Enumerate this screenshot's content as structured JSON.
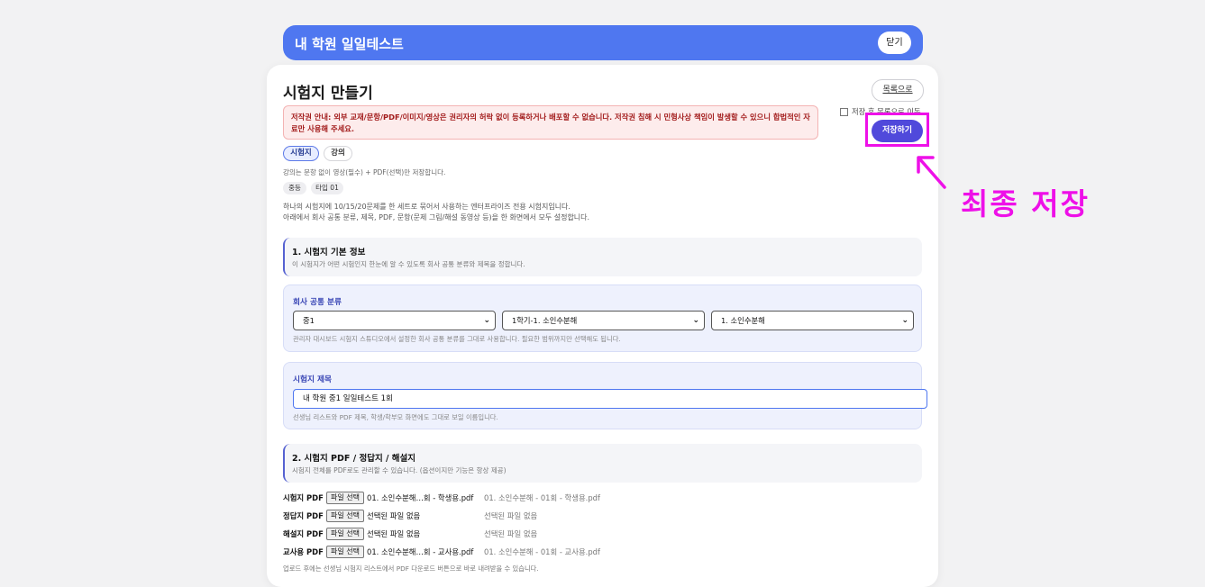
{
  "app": {
    "title": "내 학원 일일테스트",
    "close_label": "닫기"
  },
  "page": {
    "title": "시험지 만들기",
    "back_label": "목록으로"
  },
  "notice": "저작권 안내: 외부 교재/문항/PDF/이미지/영상은 권리자의 허락 없이 등록하거나 배포할 수 없습니다. 저작권 침해 시 민형사상 책임이 발생할 수 있으니 합법적인 자료만 사용해 주세요.",
  "save_option": {
    "label": "저장 후 목록으로 이동",
    "checked": false
  },
  "save_button": "저장하기",
  "annotation": "최종 저장",
  "tabs": [
    {
      "label": "시험지",
      "active": true
    },
    {
      "label": "강의",
      "active": false
    }
  ],
  "lecture_note": "강의는 문항 없이 영상(필수) + PDF(선택)만 저장합니다.",
  "chips": [
    "중등",
    "타입 01"
  ],
  "description": [
    "하나의 시험지에 10/15/20문제를 한 세트로 묶어서 사용하는 엔터프라이즈 전용 시험지입니다.",
    "아래에서 회사 공통 분류, 제목, PDF, 문항(문제 그림/해설 동영상 등)을 한 화면에서 모두 설정합니다."
  ],
  "section1": {
    "title": "1. 시험지 기본 정보",
    "desc": "이 시험지가 어떤 시험인지 한눈에 알 수 있도록 회사 공통 분류와 제목을 정합니다."
  },
  "category": {
    "label": "회사 공통 분류",
    "selects": [
      "중1",
      "1학기-1. 소인수분해",
      "1. 소인수분해"
    ],
    "hint": "관리자 대시보드 시험지 스튜디오에서 설정한 회사 공통 분류를 그대로 사용합니다. 필요한 범위까지만 선택해도 됩니다."
  },
  "title_field": {
    "label": "시험지 제목",
    "value": "내 학원 중1 일일테스트 1회",
    "hint": "선생님 리스트와 PDF 제목, 학생/학부모 화면에도 그대로 보일 이름입니다."
  },
  "section2": {
    "title": "2. 시험지 PDF / 정답지 / 해설지",
    "desc": "시험지 전체를 PDF로도 관리할 수 있습니다. (옵션이지만 기능은 항상 제공)"
  },
  "files": [
    {
      "label": "시험지 PDF",
      "button": "파일 선택",
      "chosen": "01. 소인수분해…회 - 학생용.pdf",
      "stored": "01. 소인수분해 - 01회 - 학생용.pdf"
    },
    {
      "label": "정답지 PDF",
      "button": "파일 선택",
      "chosen": "선택된 파일 없음",
      "stored": "선택된 파일 없음"
    },
    {
      "label": "해설지 PDF",
      "button": "파일 선택",
      "chosen": "선택된 파일 없음",
      "stored": "선택된 파일 없음"
    },
    {
      "label": "교사용 PDF",
      "button": "파일 선택",
      "chosen": "01. 소인수분해…회 - 교사용.pdf",
      "stored": "01. 소인수분해 - 01회 - 교사용.pdf"
    }
  ],
  "files_hint": "업로드 후에는 선생님 시험지 리스트에서 PDF 다운로드 버튼으로 바로 내려받을 수 있습니다.",
  "colors": {
    "accent": "#4f77f0",
    "save": "#5049db",
    "highlight": "#ee10e8",
    "notice": "#a31d1d"
  }
}
